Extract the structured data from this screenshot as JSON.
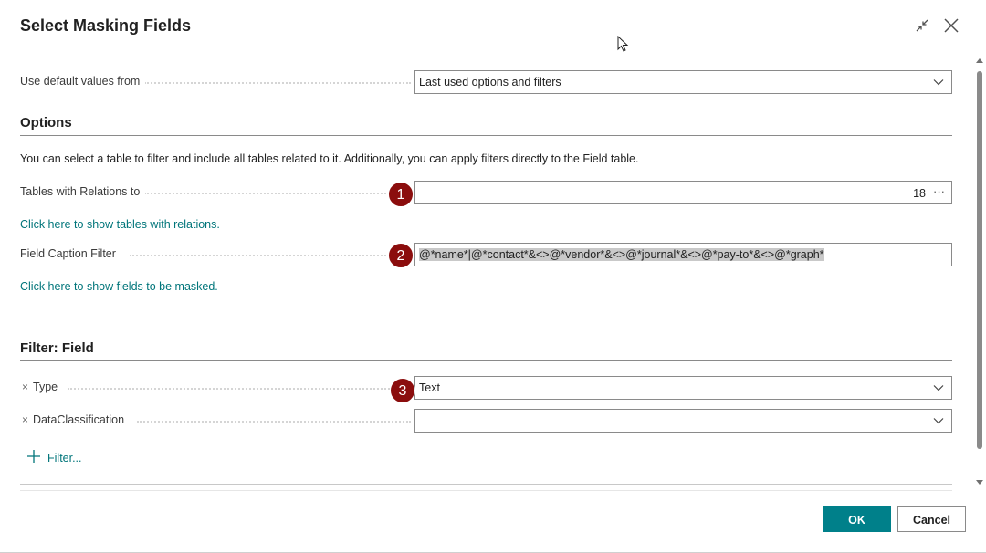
{
  "dialog": {
    "title": "Select Masking Fields",
    "collapse_icon": "collapse-icon",
    "close_icon": "close-icon"
  },
  "defaults": {
    "label": "Use default values from",
    "value": "Last used options and filters"
  },
  "options": {
    "title": "Options",
    "description": "You can select a table to filter and include all tables related to it. Additionally, you can apply filters directly to the Field table.",
    "tables_label": "Tables with Relations to",
    "tables_value": "18",
    "tables_link": "Click here to show tables with relations.",
    "caption_label": "Field Caption Filter",
    "caption_value": "@*name*|@*contact*&<>@*vendor*&<>@*journal*&<>@*pay-to*&<>@*graph*",
    "fields_link": "Click here to show fields to be masked."
  },
  "filter": {
    "title": "Filter: Field",
    "type_label": "Type",
    "type_value": "Text",
    "classification_label": "DataClassification",
    "classification_value": "",
    "add_filter_label": "Filter...",
    "remove_symbol": "×"
  },
  "badges": [
    "1",
    "2",
    "3"
  ],
  "buttons": {
    "ok": "OK",
    "cancel": "Cancel"
  },
  "colors": {
    "accent": "#00808a",
    "link": "#00757a",
    "badge": "#8b0d0d"
  }
}
